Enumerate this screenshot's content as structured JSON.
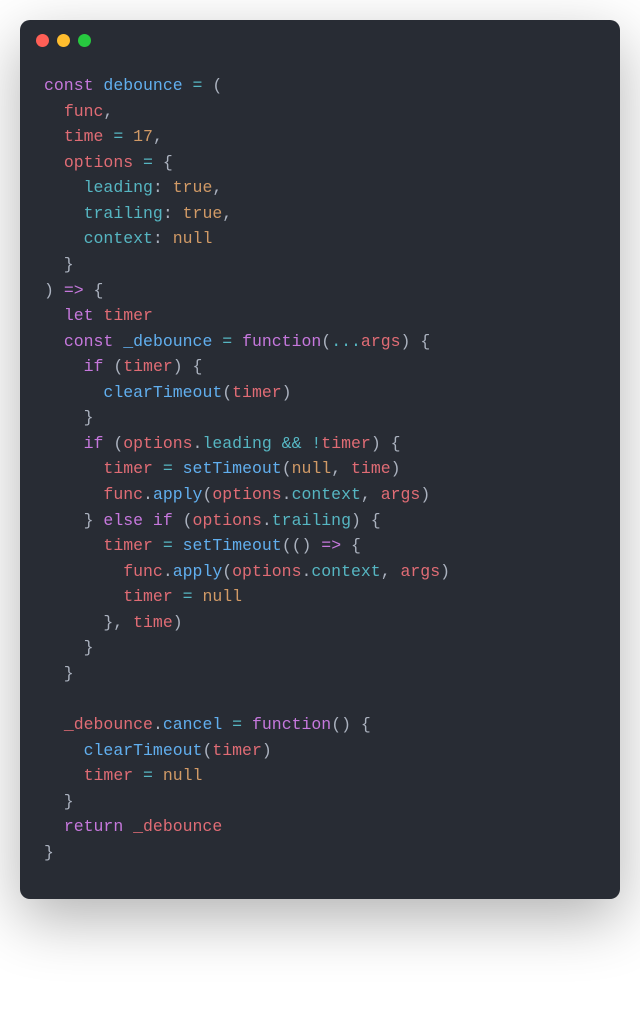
{
  "code": {
    "tokens": [
      [
        {
          "t": "const ",
          "c": "kw"
        },
        {
          "t": "debounce",
          "c": "fn"
        },
        {
          "t": " ",
          "c": "punct"
        },
        {
          "t": "=",
          "c": "op"
        },
        {
          "t": " (",
          "c": "punct"
        }
      ],
      [
        {
          "t": "  ",
          "c": "punct"
        },
        {
          "t": "func",
          "c": "param"
        },
        {
          "t": ",",
          "c": "punct"
        }
      ],
      [
        {
          "t": "  ",
          "c": "punct"
        },
        {
          "t": "time",
          "c": "param"
        },
        {
          "t": " ",
          "c": "punct"
        },
        {
          "t": "=",
          "c": "op"
        },
        {
          "t": " ",
          "c": "punct"
        },
        {
          "t": "17",
          "c": "num"
        },
        {
          "t": ",",
          "c": "punct"
        }
      ],
      [
        {
          "t": "  ",
          "c": "punct"
        },
        {
          "t": "options",
          "c": "param"
        },
        {
          "t": " ",
          "c": "punct"
        },
        {
          "t": "=",
          "c": "op"
        },
        {
          "t": " {",
          "c": "punct"
        }
      ],
      [
        {
          "t": "    ",
          "c": "punct"
        },
        {
          "t": "leading",
          "c": "prop"
        },
        {
          "t": ": ",
          "c": "punct"
        },
        {
          "t": "true",
          "c": "bool"
        },
        {
          "t": ",",
          "c": "punct"
        }
      ],
      [
        {
          "t": "    ",
          "c": "punct"
        },
        {
          "t": "trailing",
          "c": "prop"
        },
        {
          "t": ": ",
          "c": "punct"
        },
        {
          "t": "true",
          "c": "bool"
        },
        {
          "t": ",",
          "c": "punct"
        }
      ],
      [
        {
          "t": "    ",
          "c": "punct"
        },
        {
          "t": "context",
          "c": "prop"
        },
        {
          "t": ": ",
          "c": "punct"
        },
        {
          "t": "null",
          "c": "bool"
        }
      ],
      [
        {
          "t": "  }",
          "c": "punct"
        }
      ],
      [
        {
          "t": ") ",
          "c": "punct"
        },
        {
          "t": "=>",
          "c": "kw"
        },
        {
          "t": " {",
          "c": "punct"
        }
      ],
      [
        {
          "t": "  ",
          "c": "punct"
        },
        {
          "t": "let ",
          "c": "kw"
        },
        {
          "t": "timer",
          "c": "param"
        }
      ],
      [
        {
          "t": "  ",
          "c": "punct"
        },
        {
          "t": "const ",
          "c": "kw"
        },
        {
          "t": "_debounce",
          "c": "fn"
        },
        {
          "t": " ",
          "c": "punct"
        },
        {
          "t": "=",
          "c": "op"
        },
        {
          "t": " ",
          "c": "punct"
        },
        {
          "t": "function",
          "c": "kw"
        },
        {
          "t": "(",
          "c": "punct"
        },
        {
          "t": "...",
          "c": "op"
        },
        {
          "t": "args",
          "c": "param"
        },
        {
          "t": ") {",
          "c": "punct"
        }
      ],
      [
        {
          "t": "    ",
          "c": "punct"
        },
        {
          "t": "if ",
          "c": "kw"
        },
        {
          "t": "(",
          "c": "punct"
        },
        {
          "t": "timer",
          "c": "param"
        },
        {
          "t": ") {",
          "c": "punct"
        }
      ],
      [
        {
          "t": "      ",
          "c": "punct"
        },
        {
          "t": "clearTimeout",
          "c": "fn"
        },
        {
          "t": "(",
          "c": "punct"
        },
        {
          "t": "timer",
          "c": "param"
        },
        {
          "t": ")",
          "c": "punct"
        }
      ],
      [
        {
          "t": "    }",
          "c": "punct"
        }
      ],
      [
        {
          "t": "    ",
          "c": "punct"
        },
        {
          "t": "if ",
          "c": "kw"
        },
        {
          "t": "(",
          "c": "punct"
        },
        {
          "t": "options",
          "c": "param"
        },
        {
          "t": ".",
          "c": "punct"
        },
        {
          "t": "leading",
          "c": "prop"
        },
        {
          "t": " ",
          "c": "punct"
        },
        {
          "t": "&&",
          "c": "op"
        },
        {
          "t": " ",
          "c": "punct"
        },
        {
          "t": "!",
          "c": "op"
        },
        {
          "t": "timer",
          "c": "param"
        },
        {
          "t": ") {",
          "c": "punct"
        }
      ],
      [
        {
          "t": "      ",
          "c": "punct"
        },
        {
          "t": "timer",
          "c": "param"
        },
        {
          "t": " ",
          "c": "punct"
        },
        {
          "t": "=",
          "c": "op"
        },
        {
          "t": " ",
          "c": "punct"
        },
        {
          "t": "setTimeout",
          "c": "fn"
        },
        {
          "t": "(",
          "c": "punct"
        },
        {
          "t": "null",
          "c": "bool"
        },
        {
          "t": ", ",
          "c": "punct"
        },
        {
          "t": "time",
          "c": "param"
        },
        {
          "t": ")",
          "c": "punct"
        }
      ],
      [
        {
          "t": "      ",
          "c": "punct"
        },
        {
          "t": "func",
          "c": "param"
        },
        {
          "t": ".",
          "c": "punct"
        },
        {
          "t": "apply",
          "c": "fn"
        },
        {
          "t": "(",
          "c": "punct"
        },
        {
          "t": "options",
          "c": "param"
        },
        {
          "t": ".",
          "c": "punct"
        },
        {
          "t": "context",
          "c": "prop"
        },
        {
          "t": ", ",
          "c": "punct"
        },
        {
          "t": "args",
          "c": "param"
        },
        {
          "t": ")",
          "c": "punct"
        }
      ],
      [
        {
          "t": "    } ",
          "c": "punct"
        },
        {
          "t": "else if ",
          "c": "kw"
        },
        {
          "t": "(",
          "c": "punct"
        },
        {
          "t": "options",
          "c": "param"
        },
        {
          "t": ".",
          "c": "punct"
        },
        {
          "t": "trailing",
          "c": "prop"
        },
        {
          "t": ") {",
          "c": "punct"
        }
      ],
      [
        {
          "t": "      ",
          "c": "punct"
        },
        {
          "t": "timer",
          "c": "param"
        },
        {
          "t": " ",
          "c": "punct"
        },
        {
          "t": "=",
          "c": "op"
        },
        {
          "t": " ",
          "c": "punct"
        },
        {
          "t": "setTimeout",
          "c": "fn"
        },
        {
          "t": "(() ",
          "c": "punct"
        },
        {
          "t": "=>",
          "c": "kw"
        },
        {
          "t": " {",
          "c": "punct"
        }
      ],
      [
        {
          "t": "        ",
          "c": "punct"
        },
        {
          "t": "func",
          "c": "param"
        },
        {
          "t": ".",
          "c": "punct"
        },
        {
          "t": "apply",
          "c": "fn"
        },
        {
          "t": "(",
          "c": "punct"
        },
        {
          "t": "options",
          "c": "param"
        },
        {
          "t": ".",
          "c": "punct"
        },
        {
          "t": "context",
          "c": "prop"
        },
        {
          "t": ", ",
          "c": "punct"
        },
        {
          "t": "args",
          "c": "param"
        },
        {
          "t": ")",
          "c": "punct"
        }
      ],
      [
        {
          "t": "        ",
          "c": "punct"
        },
        {
          "t": "timer",
          "c": "param"
        },
        {
          "t": " ",
          "c": "punct"
        },
        {
          "t": "=",
          "c": "op"
        },
        {
          "t": " ",
          "c": "punct"
        },
        {
          "t": "null",
          "c": "bool"
        }
      ],
      [
        {
          "t": "      }, ",
          "c": "punct"
        },
        {
          "t": "time",
          "c": "param"
        },
        {
          "t": ")",
          "c": "punct"
        }
      ],
      [
        {
          "t": "    }",
          "c": "punct"
        }
      ],
      [
        {
          "t": "  }",
          "c": "punct"
        }
      ],
      [
        {
          "t": "",
          "c": "punct"
        }
      ],
      [
        {
          "t": "  ",
          "c": "punct"
        },
        {
          "t": "_debounce",
          "c": "param"
        },
        {
          "t": ".",
          "c": "punct"
        },
        {
          "t": "cancel",
          "c": "fn"
        },
        {
          "t": " ",
          "c": "punct"
        },
        {
          "t": "=",
          "c": "op"
        },
        {
          "t": " ",
          "c": "punct"
        },
        {
          "t": "function",
          "c": "kw"
        },
        {
          "t": "() {",
          "c": "punct"
        }
      ],
      [
        {
          "t": "    ",
          "c": "punct"
        },
        {
          "t": "clearTimeout",
          "c": "fn"
        },
        {
          "t": "(",
          "c": "punct"
        },
        {
          "t": "timer",
          "c": "param"
        },
        {
          "t": ")",
          "c": "punct"
        }
      ],
      [
        {
          "t": "    ",
          "c": "punct"
        },
        {
          "t": "timer",
          "c": "param"
        },
        {
          "t": " ",
          "c": "punct"
        },
        {
          "t": "=",
          "c": "op"
        },
        {
          "t": " ",
          "c": "punct"
        },
        {
          "t": "null",
          "c": "bool"
        }
      ],
      [
        {
          "t": "  }",
          "c": "punct"
        }
      ],
      [
        {
          "t": "  ",
          "c": "punct"
        },
        {
          "t": "return ",
          "c": "kw"
        },
        {
          "t": "_debounce",
          "c": "param"
        }
      ],
      [
        {
          "t": "}",
          "c": "punct"
        }
      ]
    ]
  }
}
